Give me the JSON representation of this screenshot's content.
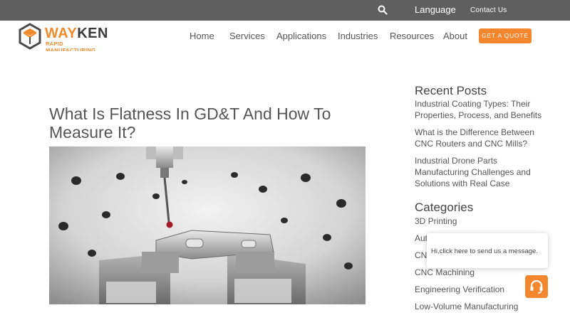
{
  "topbar": {
    "search_icon": "search-icon",
    "language_label": "Language",
    "contact_label": "Contact Us",
    "background": "#5f5f5f"
  },
  "brand": {
    "name_part1": "WAY",
    "name_part2": "KEN",
    "tagline": "RAPID MANUFACTURING",
    "accent": "#f28a2b"
  },
  "nav": {
    "items": [
      "Home",
      "Services",
      "Applications",
      "Industries",
      "Resources",
      "About"
    ],
    "cta": "GET A QUOTE"
  },
  "article": {
    "title": "What Is Flatness In GD&T And How To Measure It?",
    "hero_icon": "cmm-probe-image"
  },
  "sidebar": {
    "recent_heading": "Recent Posts",
    "recent_posts": [
      "Industrial Coating Types: Their Properties, Process, and Benefits",
      "What is the Difference Between CNC Routers and CNC Mills?",
      "Industrial Drone Parts Manufacturing Challenges and Solutions with Real Case"
    ],
    "categories_heading": "Categories",
    "categories": [
      "3D Printing",
      "Aut",
      "CNC",
      "CNC Machining",
      "Engineering Verification",
      "Low-Volume Manufacturing"
    ]
  },
  "chat": {
    "message": "Hi,click here to send us a message.",
    "icon": "headset-icon"
  }
}
